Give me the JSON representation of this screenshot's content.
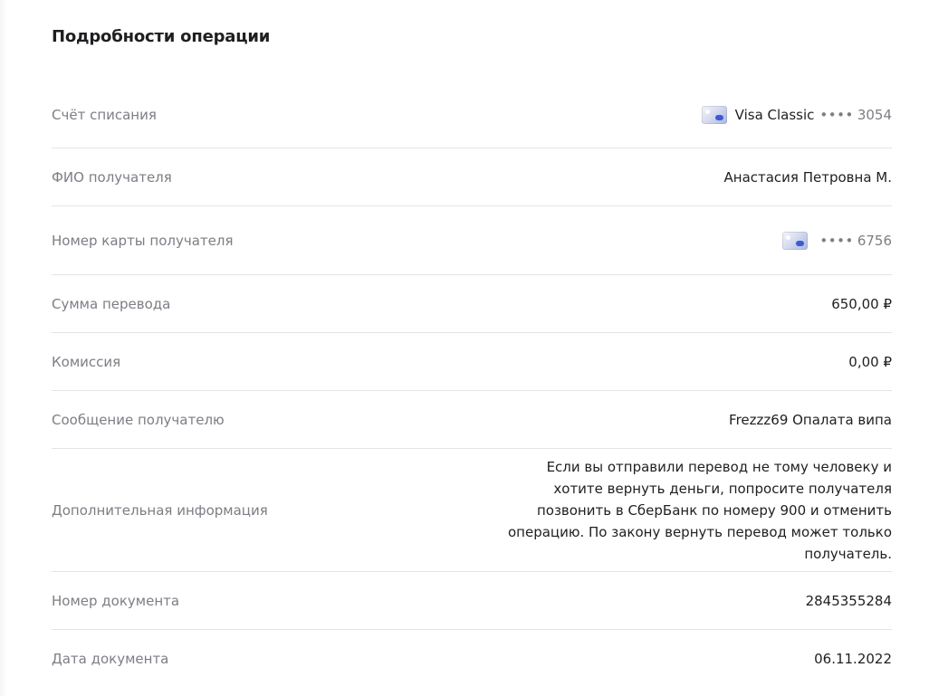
{
  "page": {
    "title": "Подробности операции"
  },
  "rows": [
    {
      "label": "Счёт списания",
      "card_icon": "card-icon",
      "card_name": "Visa Classic",
      "mask": "••••",
      "digits": "3054"
    },
    {
      "label": "ФИО получателя",
      "value": "Анастасия Петровна М."
    },
    {
      "label": "Номер карты получателя",
      "card_icon": "card-icon",
      "mask": "••••",
      "digits": "6756"
    },
    {
      "label": "Сумма перевода",
      "value": "650,00 ₽"
    },
    {
      "label": "Комиссия",
      "value": "0,00 ₽"
    },
    {
      "label": "Сообщение получателю",
      "value": "Frezzz69 Опалата випа"
    },
    {
      "label": "Дополнительная информация",
      "value": "Если вы отправили перевод не тому человеку и хотите вернуть деньги, попросите получателя позвонить в СберБанк по номеру 900 и отменить операцию. По закону вернуть перевод может только получатель."
    },
    {
      "label": "Номер документа",
      "value": "2845355284"
    },
    {
      "label": "Дата документа",
      "value": "06.11.2022"
    }
  ]
}
